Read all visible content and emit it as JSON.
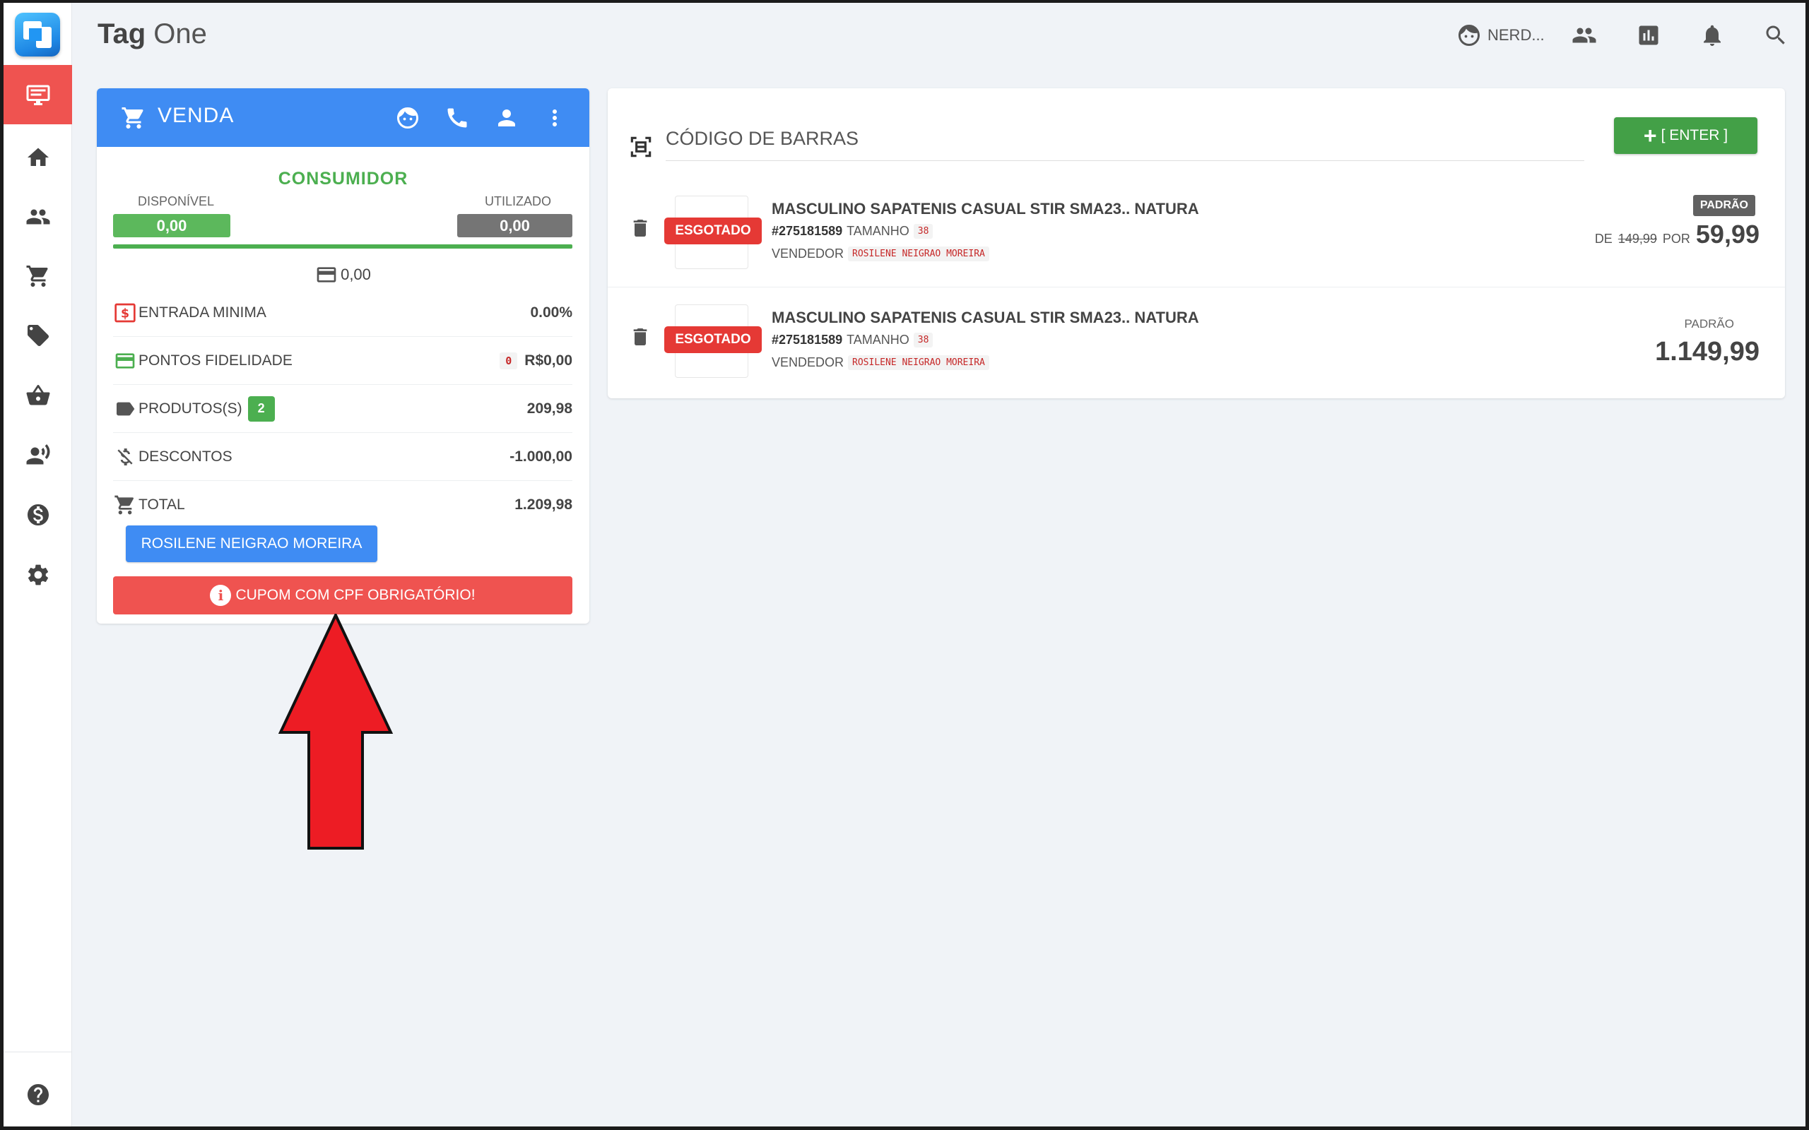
{
  "app": {
    "title_bold": "Tag",
    "title_rest": " One"
  },
  "topbar": {
    "user_name": "NERD..."
  },
  "sale": {
    "title": "VENDA",
    "customer": "CONSUMIDOR",
    "available_label": "DISPONÍVEL",
    "available_value": "0,00",
    "used_label": "UTILIZADO",
    "used_value": "0,00",
    "card_amount": "0,00",
    "rows": [
      {
        "label": "ENTRADA MINIMA",
        "value": "0.00%"
      },
      {
        "label": "PONTOS FIDELIDADE",
        "points": "0",
        "value": "R$0,00"
      },
      {
        "label": "PRODUTOS(S)",
        "count": "2",
        "value": "209,98"
      },
      {
        "label": "DESCONTOS",
        "value": "-1.000,00"
      },
      {
        "label": "TOTAL",
        "value": "1.209,98"
      }
    ],
    "seller_button": "ROSILENE NEIGRAO MOREIRA",
    "alert": "CUPOM COM CPF OBRIGATÓRIO!"
  },
  "barcode": {
    "title": "CÓDIGO DE BARRAS",
    "enter_label": "[ ENTER ]",
    "items": [
      {
        "status": "ESGOTADO",
        "name": "MASCULINO SAPATENIS CASUAL STIR SMA23.. NATURA",
        "code": "#275181589",
        "size_label": "TAMANHO",
        "size": "38",
        "seller_label": "VENDEDOR",
        "seller": "ROSILENE NEIGRAO MOREIRA",
        "price_tag": "PADRÃO",
        "from_label": "DE",
        "old_price": "149,99",
        "by_label": "POR",
        "price": "59,99"
      },
      {
        "status": "ESGOTADO",
        "name": "MASCULINO SAPATENIS CASUAL STIR SMA23.. NATURA",
        "code": "#275181589",
        "size_label": "TAMANHO",
        "size": "38",
        "seller_label": "VENDEDOR",
        "seller": "ROSILENE NEIGRAO MOREIRA",
        "price_tag": "PADRÃO",
        "price": "1.149,99"
      }
    ]
  },
  "colors": {
    "primary": "#3f8cf3",
    "danger": "#ef5350",
    "success": "#4caf50",
    "arrow": "#ed1c24"
  }
}
